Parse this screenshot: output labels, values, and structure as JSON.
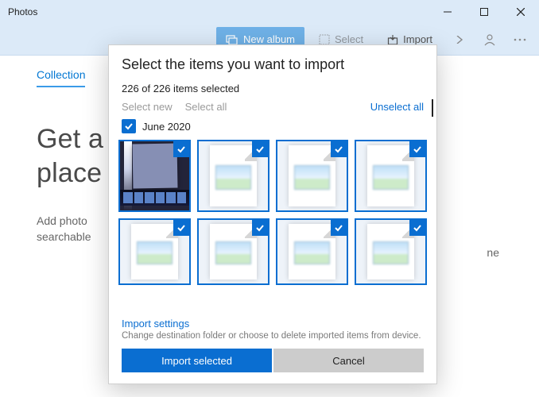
{
  "window": {
    "title": "Photos"
  },
  "commandbar": {
    "new_album_label": "New album",
    "select_label": "Select",
    "import_label": "Import"
  },
  "tabs": {
    "collection": "Collection"
  },
  "hero": {
    "line1": "Get a",
    "line2": "place"
  },
  "sub": {
    "line1": "Add photo",
    "line2": "searchable",
    "trailing": "ne"
  },
  "dialog": {
    "title": "Select the items you want to import",
    "count_text": "226 of 226 items selected",
    "select_new": "Select new",
    "select_all": "Select all",
    "unselect_all": "Unselect all",
    "month_label": "June 2020",
    "settings_title": "Import settings",
    "settings_sub": "Change destination folder or choose to delete imported items from device.",
    "import_btn": "Import selected",
    "cancel_btn": "Cancel"
  },
  "selection": {
    "total": 226,
    "selected": 226,
    "month_checked": true
  },
  "colors": {
    "accent": "#0a6ed1",
    "header_bg": "#dceaf8"
  }
}
